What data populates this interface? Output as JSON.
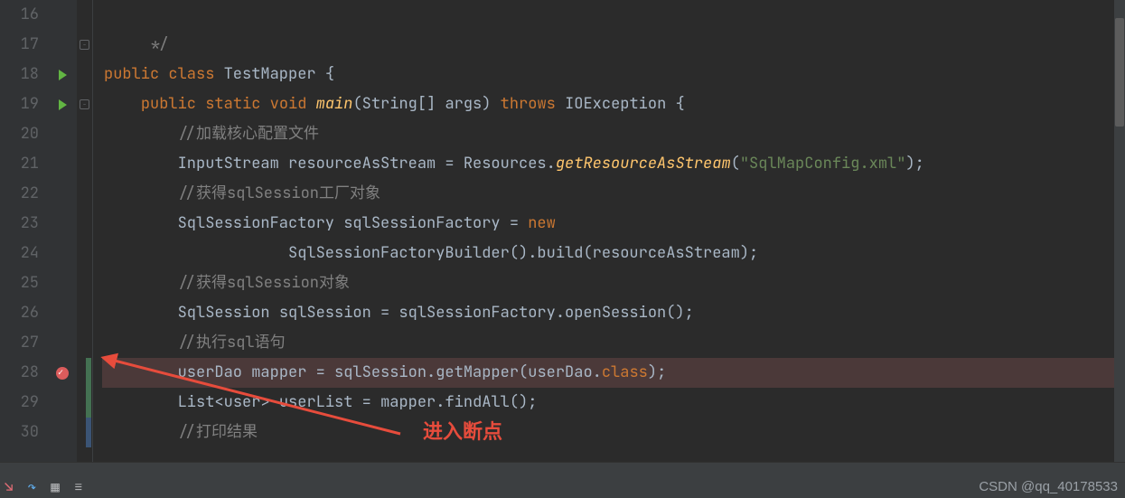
{
  "lines": {
    "16": "16",
    "17": "17",
    "18": "18",
    "19": "19",
    "20": "20",
    "21": "21",
    "22": "22",
    "23": "23",
    "24": "24",
    "25": "25",
    "26": "26",
    "27": "27",
    "28": "28",
    "29": "29",
    "30": "30"
  },
  "tokens": {
    "l17_cmt": " */",
    "l18_public": "public",
    "l18_class": "class",
    "l18_name": " TestMapper ",
    "l18_brace": "{",
    "l19_public": "public",
    "l19_static": "static",
    "l19_void": "void",
    "l19_main": " main",
    "l19_paren_o": "(",
    "l19_string": "String",
    "l19_brackets": "[] ",
    "l19_args": "args",
    "l19_paren_c": ")",
    "l19_throws": "throws",
    "l19_io": " IOException ",
    "l19_brace": "{",
    "l20_cmt": "//加载核心配置文件",
    "l21_is": "InputStream ",
    "l21_var": "resourceAsStream ",
    "l21_eq": "= ",
    "l21_res": "Resources",
    "l21_dot": ".",
    "l21_get": "getResourceAsStream",
    "l21_po": "(",
    "l21_str": "\"SqlMapConfig.xml\"",
    "l21_pc": ")",
    "l21_semi": ";",
    "l22_cmt": "//获得sqlSession工厂对象",
    "l23_t": "SqlSessionFactory ",
    "l23_v": "sqlSessionFactory ",
    "l23_eq": "= ",
    "l23_new": "new",
    "l24_t": "SqlSessionFactoryBuilder",
    "l24_po": "()",
    "l24_d": ".",
    "l24_b": "build",
    "l24_po2": "(",
    "l24_arg": "resourceAsStream",
    "l24_pc": ")",
    "l24_s": ";",
    "l25_cmt": "//获得sqlSession对象",
    "l26_t": "SqlSession ",
    "l26_v": "sqlSession ",
    "l26_eq": "= ",
    "l26_f": "sqlSessionFactory",
    "l26_d": ".",
    "l26_m": "openSession",
    "l26_p": "()",
    "l26_s": ";",
    "l27_cmt": "//执行sql语句",
    "l28_t": "userDao ",
    "l28_v": "mapper ",
    "l28_eq": "= ",
    "l28_s": "sqlSession",
    "l28_d": ".",
    "l28_m": "getMapper",
    "l28_po": "(",
    "l28_a": "userDao",
    "l28_d2": ".",
    "l28_c": "class",
    "l28_pc": ")",
    "l28_semi": ";",
    "l29_t": "List",
    "l29_lt": "<",
    "l29_u": "user",
    "l29_gt": "> ",
    "l29_v": "userList ",
    "l29_eq": "= ",
    "l29_m": "mapper",
    "l29_d": ".",
    "l29_f": "findAll",
    "l29_p": "()",
    "l29_s": ";",
    "l30_cmt": "//打印结果"
  },
  "annotation": {
    "arrow_label": "进入断点"
  },
  "watermark": "CSDN @qq_40178533",
  "indent": {
    "i1": "    ",
    "i2": "        ",
    "i3": "            ",
    "i4": "                    "
  }
}
